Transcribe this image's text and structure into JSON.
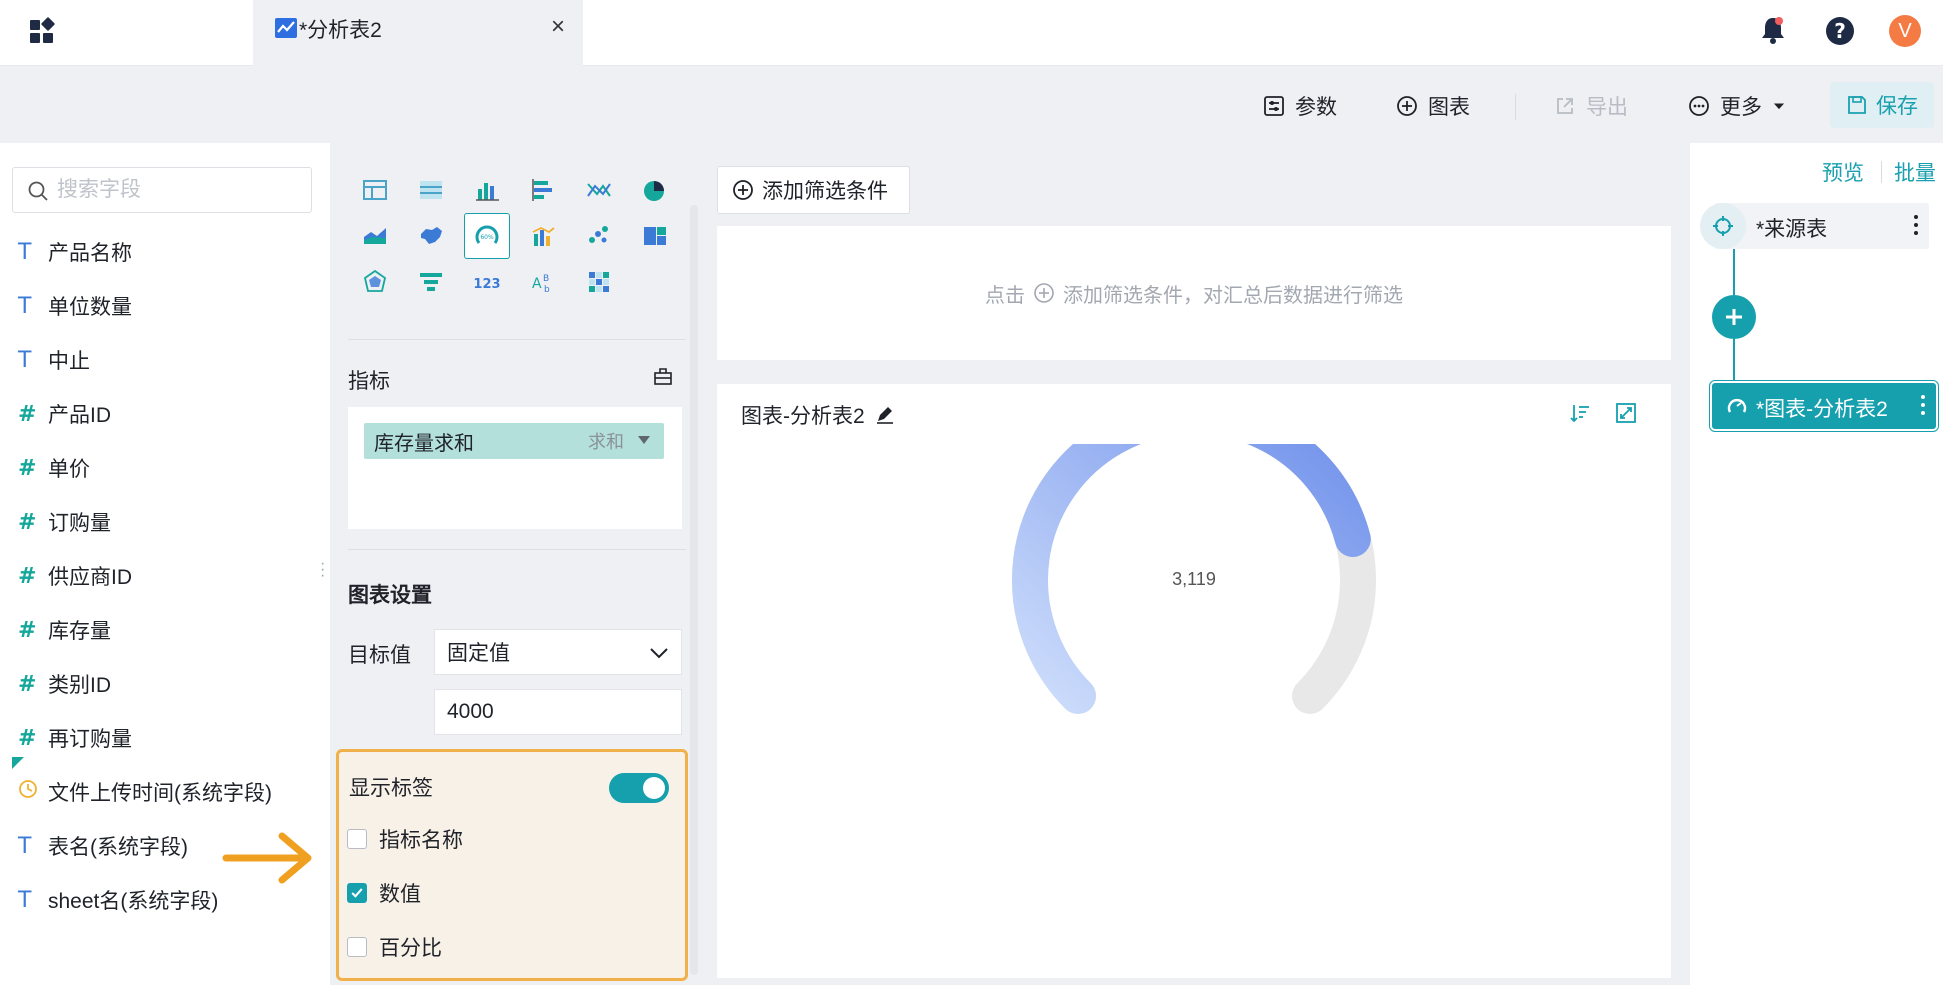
{
  "window": {
    "tab_title": "*分析表2",
    "avatar_letter": "V"
  },
  "toolbar": {
    "params": "参数",
    "chart": "图表",
    "export": "导出",
    "more": "更多",
    "save": "保存"
  },
  "fields": {
    "search_placeholder": "搜索字段",
    "items": [
      {
        "type": "text",
        "label": "产品名称"
      },
      {
        "type": "text",
        "label": "单位数量"
      },
      {
        "type": "text",
        "label": "中止"
      },
      {
        "type": "number",
        "label": "产品ID"
      },
      {
        "type": "number",
        "label": "单价"
      },
      {
        "type": "number",
        "label": "订购量"
      },
      {
        "type": "number",
        "label": "供应商ID"
      },
      {
        "type": "number",
        "label": "库存量"
      },
      {
        "type": "number",
        "label": "类别ID"
      },
      {
        "type": "number",
        "label": "再订购量"
      },
      {
        "type": "time",
        "label": "文件上传时间(系统字段)"
      },
      {
        "type": "text",
        "label": "表名(系统字段)"
      },
      {
        "type": "text",
        "label": "sheet名(系统字段)"
      }
    ]
  },
  "config": {
    "metric_section": "指标",
    "metric": {
      "name": "库存量求和",
      "agg": "求和"
    },
    "chart_settings": "图表设置",
    "target_label": "目标值",
    "target_mode": "固定值",
    "target_value": "4000",
    "show_labels": "显示标签",
    "show_labels_on": true,
    "options": [
      {
        "label": "指标名称",
        "checked": false
      },
      {
        "label": "数值",
        "checked": true
      },
      {
        "label": "百分比",
        "checked": false
      }
    ]
  },
  "canvas": {
    "add_filter": "添加筛选条件",
    "filter_hint_prefix": "点击",
    "filter_hint_suffix": "添加筛选条件，对汇总后数据进行筛选",
    "chart_title": "图表-分析表2",
    "gauge_value_label": "3,119"
  },
  "chart_data": {
    "type": "gauge",
    "value": 3119,
    "target": 4000,
    "value_label": "3,119",
    "colors": {
      "start": "#cdddfb",
      "end": "#6e8fea",
      "track": "#e8e8e8"
    }
  },
  "flow": {
    "preview": "预览",
    "batch": "批量",
    "source": "*来源表",
    "chart_node": "*图表-分析表2"
  },
  "colors": {
    "accent": "#16a0ae",
    "highlight_border": "#f0b14a",
    "arrow": "#f0a020"
  }
}
